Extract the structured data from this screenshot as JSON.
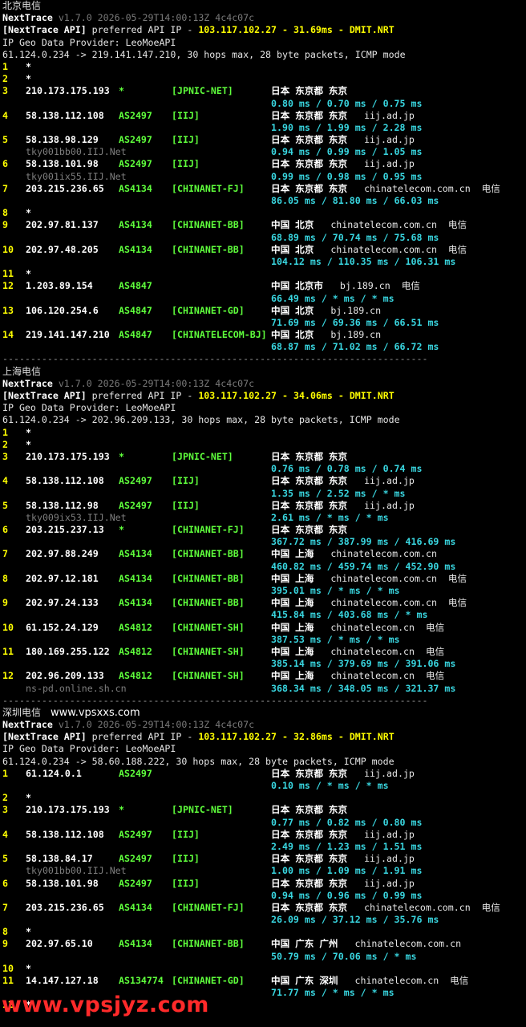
{
  "watermark": "www.vpsjyz.com",
  "sections": [
    {
      "title": "北京电信",
      "site": "",
      "tool": "NextTrace",
      "version": "v1.7.0 2026-05-29T14:00:13Z 4c4c07c",
      "api_label": "[NextTrace API]",
      "api_text": " preferred API IP - ",
      "api_ip": "103.117.102.27",
      "api_latency": "31.69ms",
      "api_node": "DMIT.NRT",
      "geo_provider": "IP Geo Data Provider: LeoMoeAPI",
      "route": "61.124.0.234 -> 219.141.147.210, 30 hops max, 28 byte packets, ICMP mode",
      "hops": [
        {
          "no": "1",
          "star": "*"
        },
        {
          "no": "2",
          "star": "*"
        },
        {
          "no": "3",
          "ip": "210.173.175.193",
          "as": "*",
          "net": "[JPNIC-NET]",
          "geo": "日本 东京都 东京",
          "rdns": "",
          "isp": "",
          "rtt": "0.80 ms / 0.70 ms / 0.75 ms"
        },
        {
          "no": "4",
          "ip": "58.138.112.108",
          "as": "AS2497",
          "net": "[IIJ]",
          "geo": "日本 东京都 东京",
          "rdns": "iij.ad.jp",
          "isp": "",
          "rtt": "1.90 ms / 1.99 ms / 2.28 ms"
        },
        {
          "no": "5",
          "ip": "58.138.98.129",
          "as": "AS2497",
          "net": "[IIJ]",
          "geo": "日本 东京都 东京",
          "rdns": "iij.ad.jp",
          "isp": "",
          "host": "tky001bb00.IIJ.Net",
          "rtt": "0.94 ms / 0.99 ms / 1.05 ms"
        },
        {
          "no": "6",
          "ip": "58.138.101.98",
          "as": "AS2497",
          "net": "[IIJ]",
          "geo": "日本 东京都 东京",
          "rdns": "iij.ad.jp",
          "isp": "",
          "host": "tky001ix55.IIJ.Net",
          "rtt": "0.99 ms / 0.98 ms / 0.95 ms"
        },
        {
          "no": "7",
          "ip": "203.215.236.65",
          "as": "AS4134",
          "net": "[CHINANET-FJ]",
          "geo": "日本 东京都 东京",
          "rdns": "chinatelecom.com.cn",
          "isp": "电信",
          "rtt": "86.05 ms / 81.80 ms / 66.03 ms"
        },
        {
          "no": "8",
          "star": "*"
        },
        {
          "no": "9",
          "ip": "202.97.81.137",
          "as": "AS4134",
          "net": "[CHINANET-BB]",
          "geo": "中国 北京",
          "rdns": "chinatelecom.com.cn",
          "isp": "电信",
          "rtt": "68.89 ms / 70.74 ms / 75.68 ms"
        },
        {
          "no": "10",
          "ip": "202.97.48.205",
          "as": "AS4134",
          "net": "[CHINANET-BB]",
          "geo": "中国 北京",
          "rdns": "chinatelecom.com.cn",
          "isp": "电信",
          "rtt": "104.12 ms / 110.35 ms / 106.31 ms"
        },
        {
          "no": "11",
          "star": "*"
        },
        {
          "no": "12",
          "ip": "1.203.89.154",
          "as": "AS4847",
          "net": "",
          "geo": "中国 北京市",
          "rdns": "bj.189.cn",
          "isp": "电信",
          "rtt": "66.49 ms / * ms / * ms"
        },
        {
          "no": "13",
          "ip": "106.120.254.6",
          "as": "AS4847",
          "net": "[CHINANET-GD]",
          "geo": "中国 北京",
          "rdns": "bj.189.cn",
          "isp": "",
          "rtt": "71.69 ms / 69.36 ms / 66.51 ms"
        },
        {
          "no": "14",
          "ip": "219.141.147.210",
          "as": "AS4847",
          "net": "[CHINATELECOM-BJ]",
          "geo": "中国 北京",
          "rdns": "bj.189.cn",
          "isp": "",
          "rtt": "68.87 ms / 71.02 ms / 66.72 ms"
        }
      ]
    },
    {
      "title": "上海电信",
      "site": "",
      "tool": "NextTrace",
      "version": "v1.7.0 2026-05-29T14:00:13Z 4c4c07c",
      "api_label": "[NextTrace API]",
      "api_text": " preferred API IP - ",
      "api_ip": "103.117.102.27",
      "api_latency": "34.06ms",
      "api_node": "DMIT.NRT",
      "geo_provider": "IP Geo Data Provider: LeoMoeAPI",
      "route": "61.124.0.234 -> 202.96.209.133, 30 hops max, 28 byte packets, ICMP mode",
      "hops": [
        {
          "no": "1",
          "star": "*"
        },
        {
          "no": "2",
          "star": "*"
        },
        {
          "no": "3",
          "ip": "210.173.175.193",
          "as": "*",
          "net": "[JPNIC-NET]",
          "geo": "日本 东京都 东京",
          "rdns": "",
          "isp": "",
          "rtt": "0.76 ms / 0.78 ms / 0.74 ms"
        },
        {
          "no": "4",
          "ip": "58.138.112.108",
          "as": "AS2497",
          "net": "[IIJ]",
          "geo": "日本 东京都 东京",
          "rdns": "iij.ad.jp",
          "isp": "",
          "rtt": "1.35 ms / 2.52 ms / * ms"
        },
        {
          "no": "5",
          "ip": "58.138.112.98",
          "as": "AS2497",
          "net": "[IIJ]",
          "geo": "日本 东京都 东京",
          "rdns": "iij.ad.jp",
          "isp": "",
          "host": "tky009ix53.IIJ.Net",
          "rtt": "2.61 ms / * ms / * ms"
        },
        {
          "no": "6",
          "ip": "203.215.237.13",
          "as": "*",
          "net": "[CHINANET-FJ]",
          "geo": "日本 东京都 东京",
          "rdns": "",
          "isp": "",
          "rtt": "367.72 ms / 387.99 ms / 416.69 ms"
        },
        {
          "no": "7",
          "ip": "202.97.88.249",
          "as": "AS4134",
          "net": "[CHINANET-BB]",
          "geo": "中国 上海",
          "rdns": "chinatelecom.com.cn",
          "isp": "",
          "rtt": "460.82 ms / 459.74 ms / 452.90 ms"
        },
        {
          "no": "8",
          "ip": "202.97.12.181",
          "as": "AS4134",
          "net": "[CHINANET-BB]",
          "geo": "中国 上海",
          "rdns": "chinatelecom.com.cn",
          "isp": "电信",
          "rtt": "395.01 ms / * ms / * ms"
        },
        {
          "no": "9",
          "ip": "202.97.24.133",
          "as": "AS4134",
          "net": "[CHINANET-BB]",
          "geo": "中国 上海",
          "rdns": "chinatelecom.com.cn",
          "isp": "电信",
          "rtt": "415.84 ms / 403.68 ms / * ms"
        },
        {
          "no": "10",
          "ip": "61.152.24.129",
          "as": "AS4812",
          "net": "[CHINANET-SH]",
          "geo": "中国 上海",
          "rdns": "chinatelecom.cn",
          "isp": "电信",
          "rtt": "387.53 ms / * ms / * ms"
        },
        {
          "no": "11",
          "ip": "180.169.255.122",
          "as": "AS4812",
          "net": "[CHINANET-SH]",
          "geo": "中国 上海",
          "rdns": "chinatelecom.cn",
          "isp": "电信",
          "rtt": "385.14 ms / 379.69 ms / 391.06 ms"
        },
        {
          "no": "12",
          "ip": "202.96.209.133",
          "as": "AS4812",
          "net": "[CHINANET-SH]",
          "geo": "中国 上海",
          "rdns": "chinatelecom.cn",
          "isp": "电信",
          "host": "ns-pd.online.sh.cn",
          "rtt": "368.34 ms / 348.05 ms / 321.37 ms"
        }
      ]
    },
    {
      "title": "深圳电信",
      "site": "www.vpsxxs.com",
      "tool": "NextTrace",
      "version": "v1.7.0 2026-05-29T14:00:13Z 4c4c07c",
      "api_label": "[NextTrace API]",
      "api_text": " preferred API IP - ",
      "api_ip": "103.117.102.27",
      "api_latency": "32.86ms",
      "api_node": "DMIT.NRT",
      "geo_provider": "IP Geo Data Provider: LeoMoeAPI",
      "route": "61.124.0.234 -> 58.60.188.222, 30 hops max, 28 byte packets, ICMP mode",
      "hops": [
        {
          "no": "1",
          "ip": "61.124.0.1",
          "as": "AS2497",
          "net": "",
          "geo": "日本 东京都 东京",
          "rdns": "iij.ad.jp",
          "isp": "",
          "rtt": "0.10 ms / * ms / * ms"
        },
        {
          "no": "2",
          "star": "*"
        },
        {
          "no": "3",
          "ip": "210.173.175.193",
          "as": "*",
          "net": "[JPNIC-NET]",
          "geo": "日本 东京都 东京",
          "rdns": "",
          "isp": "",
          "rtt": "0.77 ms / 0.82 ms / 0.80 ms"
        },
        {
          "no": "4",
          "ip": "58.138.112.108",
          "as": "AS2497",
          "net": "[IIJ]",
          "geo": "日本 东京都 东京",
          "rdns": "iij.ad.jp",
          "isp": "",
          "rtt": "2.49 ms / 1.23 ms / 1.51 ms"
        },
        {
          "no": "5",
          "ip": "58.138.84.17",
          "as": "AS2497",
          "net": "[IIJ]",
          "geo": "日本 东京都 东京",
          "rdns": "iij.ad.jp",
          "isp": "",
          "host": "tky001bb00.IIJ.Net",
          "rtt": "1.00 ms / 1.09 ms / 1.91 ms"
        },
        {
          "no": "6",
          "ip": "58.138.101.98",
          "as": "AS2497",
          "net": "[IIJ]",
          "geo": "日本 东京都 东京",
          "rdns": "iij.ad.jp",
          "isp": "",
          "rtt": "0.94 ms / 0.96 ms / 0.99 ms"
        },
        {
          "no": "7",
          "ip": "203.215.236.65",
          "as": "AS4134",
          "net": "[CHINANET-FJ]",
          "geo": "日本 东京都 东京",
          "rdns": "chinatelecom.com.cn",
          "isp": "电信",
          "rtt": "26.09 ms / 37.12 ms / 35.76 ms"
        },
        {
          "no": "8",
          "star": "*"
        },
        {
          "no": "9",
          "ip": "202.97.65.10",
          "as": "AS4134",
          "net": "[CHINANET-BB]",
          "geo": "中国 广东 广州",
          "rdns": "chinatelecom.com.cn",
          "isp": "",
          "rtt": "50.79 ms / 70.06 ms / * ms"
        },
        {
          "no": "10",
          "star": "*"
        },
        {
          "no": "11",
          "ip": "14.147.127.18",
          "as": "AS134774",
          "net": "[CHINANET-GD]",
          "geo": "中国 广东 深圳",
          "rdns": "chinatelecom.cn",
          "isp": "电信",
          "rtt": "71.77 ms / * ms / * ms"
        },
        {
          "no": "12",
          "star": "*"
        }
      ]
    }
  ],
  "separator": "----------------------------------------------------------------------------"
}
